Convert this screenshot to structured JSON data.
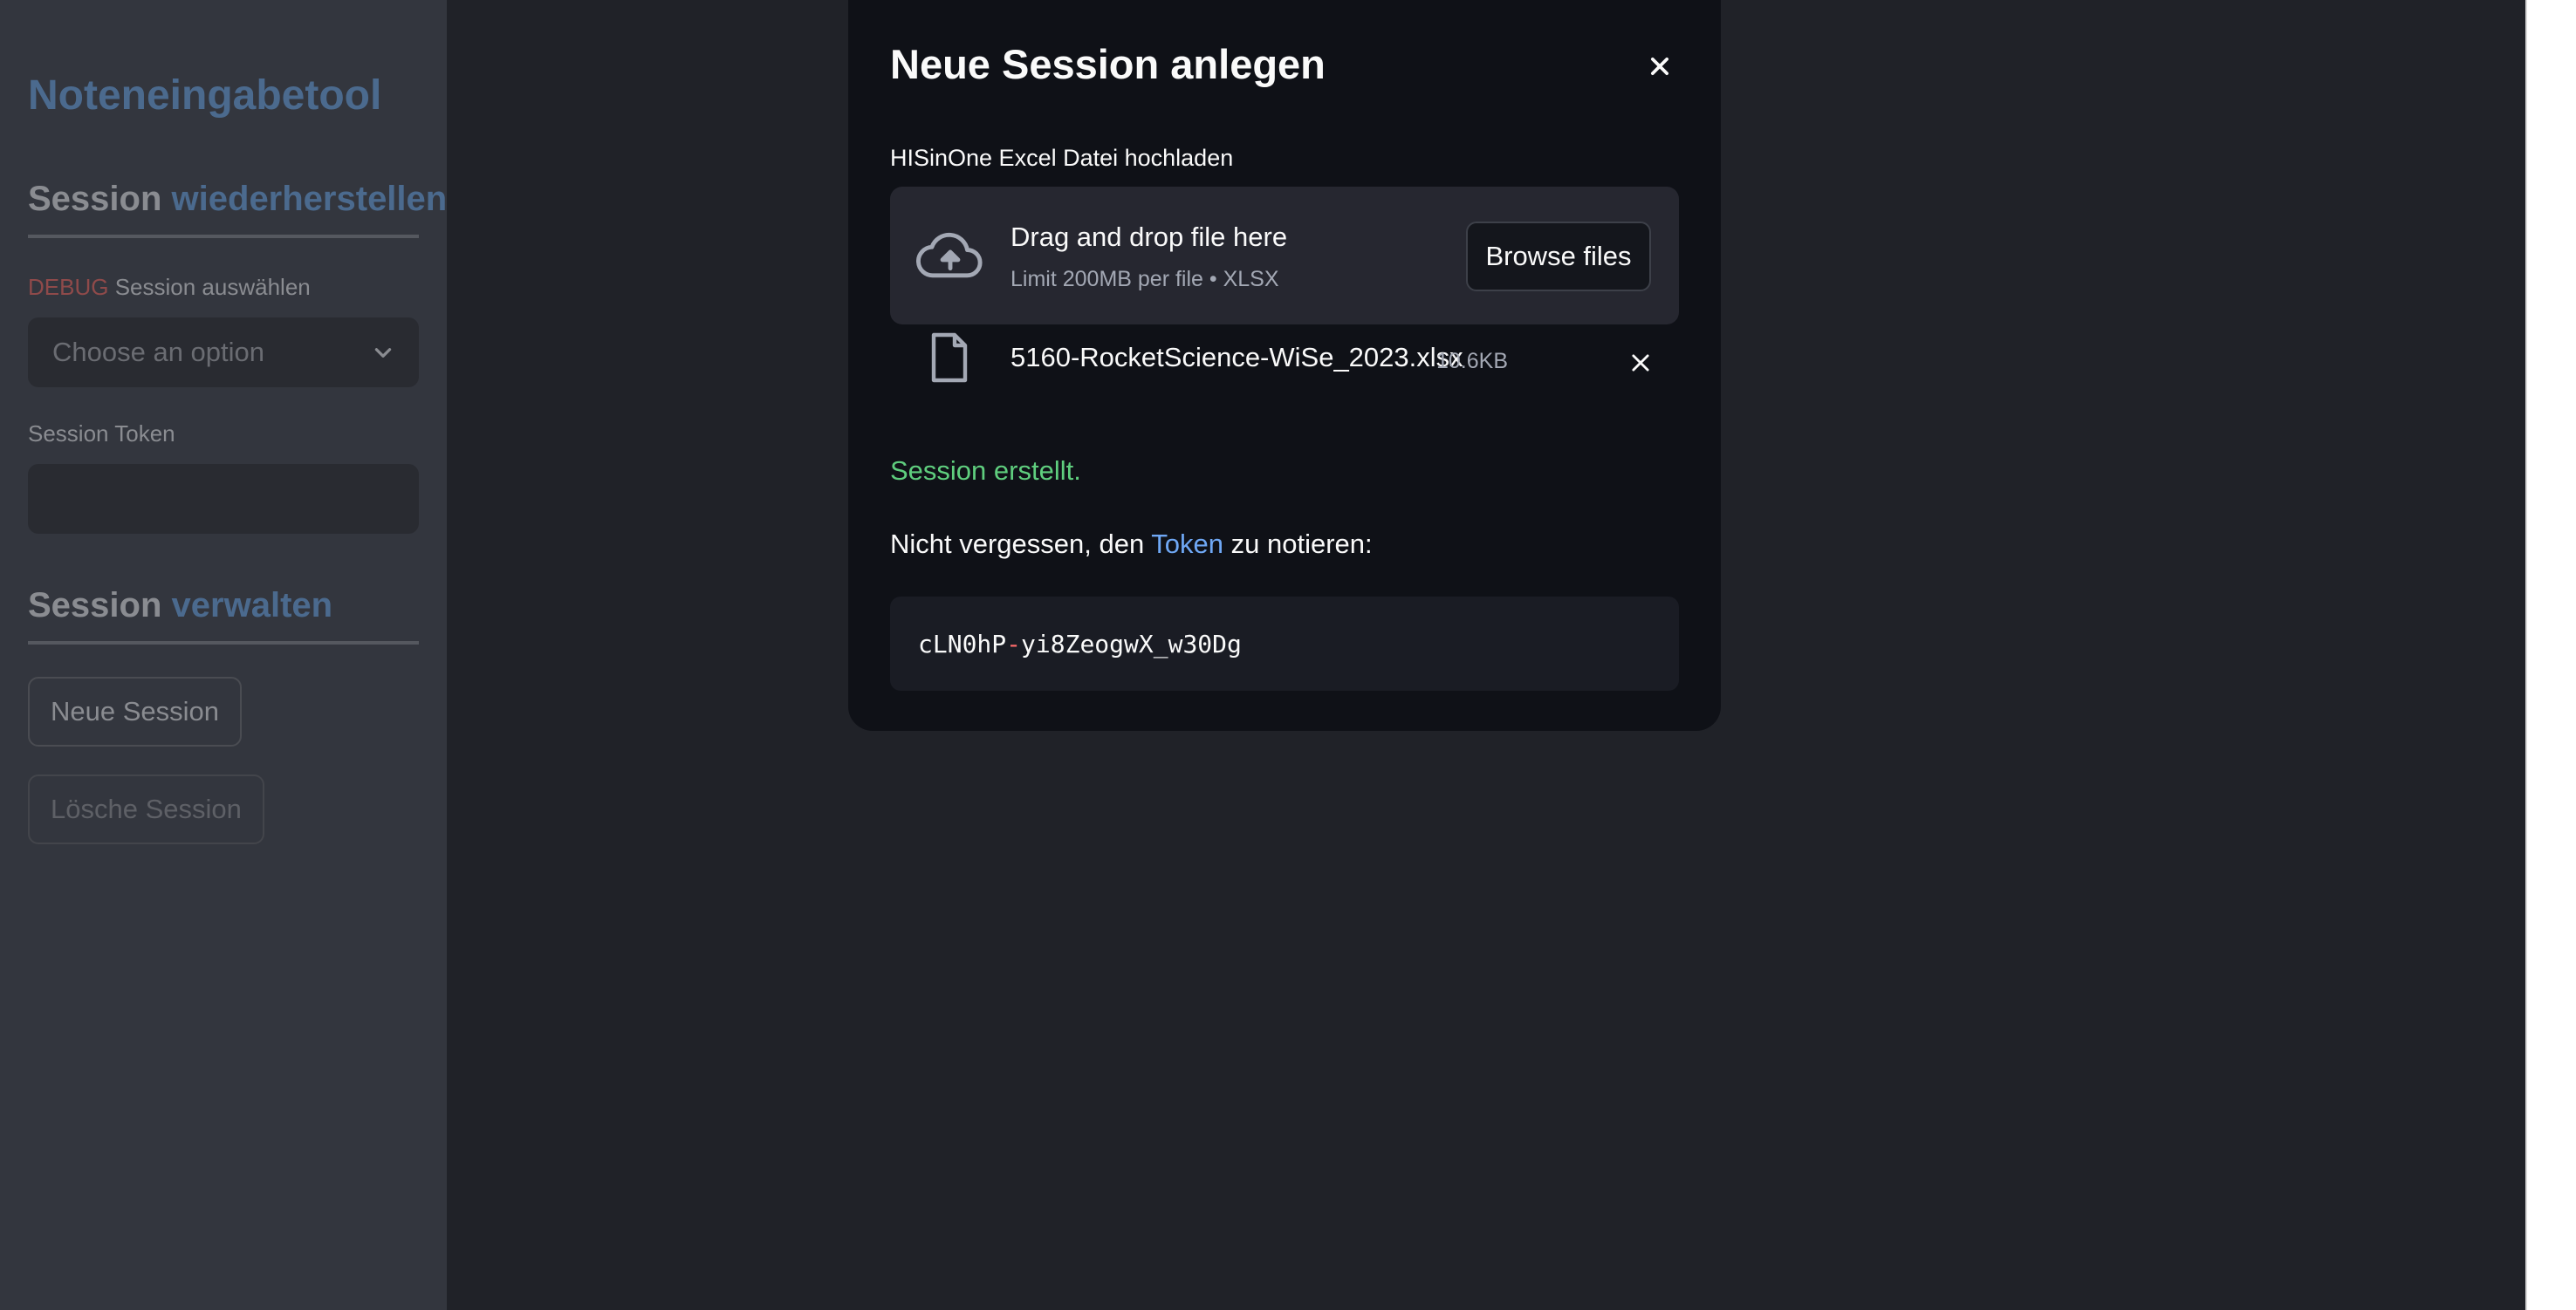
{
  "sidebar": {
    "app_title": "Noteneingabetool",
    "restore_heading": {
      "word1": "Session",
      "word2": "wiederherstellen"
    },
    "session_select": {
      "debug_tag": "DEBUG",
      "label": "Session auswählen",
      "placeholder": "Choose an option"
    },
    "token_field": {
      "label": "Session Token",
      "value": ""
    },
    "manage_heading": {
      "word1": "Session",
      "word2": "verwalten"
    },
    "buttons": {
      "new_session": "Neue Session",
      "delete_session": "Lösche Session"
    }
  },
  "modal": {
    "title": "Neue Session anlegen",
    "uploader": {
      "label": "HISinOne Excel Datei hochladen",
      "drop_title": "Drag and drop file here",
      "drop_subtitle": "Limit 200MB per file • XLSX",
      "browse_label": "Browse files"
    },
    "uploaded_file": {
      "name": "5160-RocketScience-WiSe_2023.xlsx",
      "size": "10.6KB"
    },
    "success_message": "Session erstellt.",
    "note": {
      "before": "Nicht vergessen, den ",
      "link": "Token",
      "after": " zu notieren:"
    },
    "token": {
      "part1": "cLN0hP",
      "separator": "-",
      "part2": "yi8ZeogwX_w30Dg"
    }
  },
  "colors": {
    "accent_blue": "#4b6a8e",
    "success_green": "#5fce7e",
    "link_blue": "#6fa8f5",
    "debug_red": "#8f4a4a"
  },
  "icons": [
    "chevron-down-icon",
    "close-icon",
    "cloud-upload-icon",
    "file-icon",
    "remove-file-icon"
  ]
}
